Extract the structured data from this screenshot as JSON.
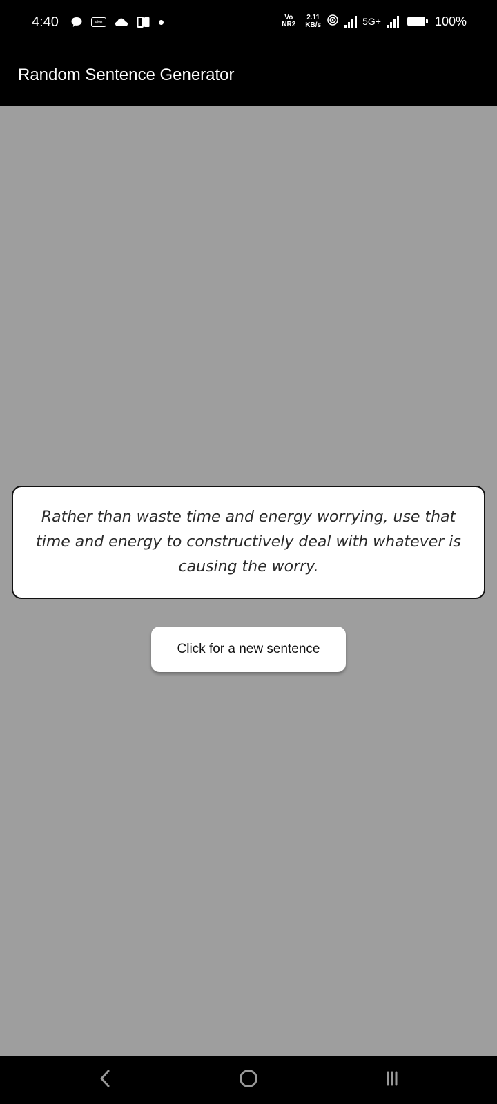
{
  "status_bar": {
    "time": "4:40",
    "volte_top": "Vo",
    "volte_bottom": "NR2",
    "net_speed_value": "2.11",
    "net_speed_unit": "KB/s",
    "network_type": "5G+",
    "battery_percent": "100%",
    "vivo_badge_text": "vivo",
    "left_icons": [
      "chat-icon",
      "vivo-icon",
      "cloud-icon",
      "book-icon",
      "notification-dot"
    ],
    "right_icons": [
      "volte-icon",
      "net-speed",
      "hotspot-icon",
      "signal-icon",
      "signal-icon",
      "battery-icon"
    ]
  },
  "app_bar": {
    "title": "Random Sentence Generator"
  },
  "sentence": {
    "text": "Rather than waste time and energy worrying, use that time and energy to constructively deal with whatever is causing the worry."
  },
  "button": {
    "label": "Click for a new sentence"
  },
  "nav_bar": {
    "icons": [
      "back-icon",
      "home-icon",
      "recents-icon"
    ]
  },
  "colors": {
    "background": "#9e9e9e",
    "app_bar": "#000000",
    "card": "#ffffff",
    "text_dark": "#2a2a2a"
  }
}
